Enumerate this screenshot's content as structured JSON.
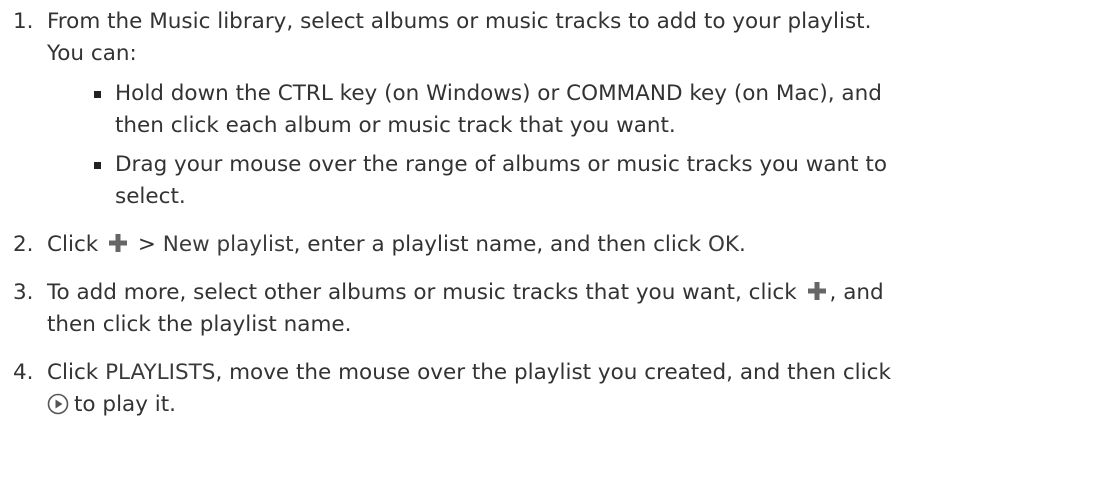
{
  "steps": [
    {
      "num": "1.",
      "line1": "From the Music library, select albums or music tracks to add to your playlist.",
      "line2": "You can:",
      "subitems": [
        {
          "line1": "Hold down the CTRL key (on Windows) or COMMAND key (on Mac), and",
          "line2": "then click each album or music track that you want."
        },
        {
          "line1": "Drag your mouse over the range of albums or music tracks you want to",
          "line2": "select."
        }
      ]
    },
    {
      "num": "2.",
      "pre": "Click",
      "sep": ">",
      "new_playlist": "New playlist",
      "mid": ", enter a playlist name, and then click",
      "ok": "OK",
      "end": "."
    },
    {
      "num": "3.",
      "line1_pre": "To add more, select other albums or music tracks that you want, click",
      "line1_post": ", and",
      "line2": "then click the playlist name."
    },
    {
      "num": "4.",
      "pre": "Click",
      "playlists": "PLAYLISTS",
      "line1_post": ", move the mouse over the playlist you created, and then click",
      "line2": "to play it."
    }
  ],
  "icons": {
    "plus": "plus-icon",
    "play": "play-circle-icon"
  },
  "colors": {
    "text": "#333333",
    "icon_gray": "#666666",
    "bullet": "#222222"
  }
}
